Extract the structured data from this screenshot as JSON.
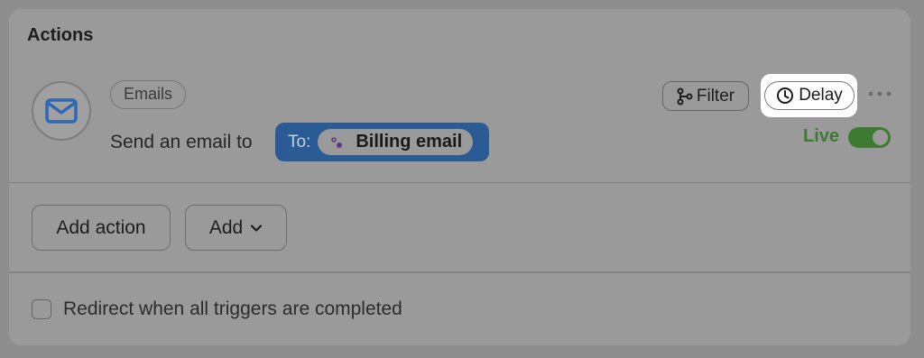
{
  "section": {
    "title": "Actions"
  },
  "action": {
    "category_tag": "Emails",
    "description": "Send an email to",
    "recipient_prefix": "To:",
    "recipient": "Billing email",
    "filter_label": "Filter",
    "delay_label": "Delay",
    "status_label": "Live",
    "status_on": true,
    "icon": "mail-icon"
  },
  "footer_buttons": {
    "add_action_label": "Add action",
    "add_label": "Add"
  },
  "options": {
    "redirect_label": "Redirect when all triggers are completed",
    "redirect_checked": false
  },
  "colors": {
    "accent_blue": "#2a5b94",
    "live_green": "#3f7a32",
    "mail_icon": "#2e67b5"
  }
}
